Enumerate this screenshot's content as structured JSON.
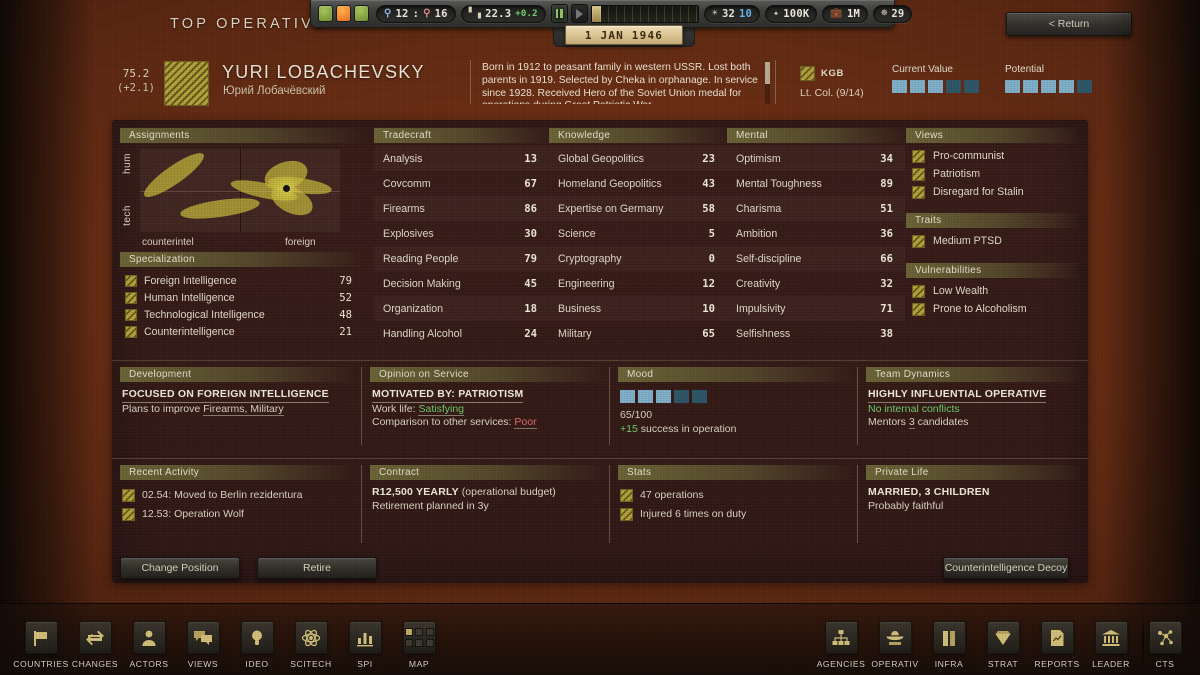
{
  "window": {
    "page_title": "TOP OPERATIVE",
    "return_label": "< Return"
  },
  "statusbar": {
    "dots": [
      "green",
      "orange",
      "green"
    ],
    "population_pill": {
      "blue_value": "12",
      "separator": ":",
      "red_value": "16"
    },
    "economy_pill": {
      "value": "22.3",
      "delta": "+0.2"
    },
    "date": "1 JAN 1946",
    "agents_pill": {
      "value": "32",
      "secondary": "10"
    },
    "money_pill": "100K",
    "budget_pill": "1M",
    "network_pill": "29"
  },
  "operative": {
    "score": "75.2",
    "score_delta": "(+2.1)",
    "name": "YURI LOBACHEVSKY",
    "name_native": "Юрий Лобачёвский",
    "biography": "Born in 1912 to peasant family in western USSR. Lost both parents in 1919. Selected by Cheka in orphanage. In service since 1928.  Received Hero of the Soviet Union medal for operations during Great Patriotic War.",
    "agency": "KGB",
    "rank": "Lt. Col. (9/14)",
    "current_value": {
      "label": "Current Value",
      "filled": 3,
      "total": 5
    },
    "potential": {
      "label": "Potential",
      "filled": 4,
      "total": 5
    }
  },
  "assignments": {
    "title": "Assignments",
    "axis_y_top": "hum",
    "axis_y_bottom": "tech",
    "axis_x_left": "counterintel",
    "axis_x_right": "foreign"
  },
  "chart_data": {
    "type": "scatter",
    "title": "Assignments",
    "xlabel": "counterintel — foreign",
    "ylabel": "tech — hum",
    "xlim": [
      0,
      100
    ],
    "ylim": [
      0,
      100
    ],
    "grid": true,
    "current_point": {
      "x": 73,
      "y": 52
    },
    "blobs": [
      {
        "x": 17,
        "y": 68,
        "rx": 18,
        "ry": 11,
        "rot": -35
      },
      {
        "x": 40,
        "y": 28,
        "rx": 20,
        "ry": 10,
        "rot": -8
      },
      {
        "x": 62,
        "y": 50,
        "rx": 17,
        "ry": 9,
        "rot": 12
      },
      {
        "x": 73,
        "y": 68,
        "rx": 11,
        "ry": 16,
        "rot": -18
      },
      {
        "x": 80,
        "y": 56,
        "rx": 16,
        "ry": 9,
        "rot": 8
      },
      {
        "x": 76,
        "y": 38,
        "rx": 11,
        "ry": 15,
        "rot": 25
      }
    ]
  },
  "specialization": {
    "title": "Specialization",
    "items": [
      {
        "label": "Foreign Intelligence",
        "value": "79"
      },
      {
        "label": "Human Intelligence",
        "value": "52"
      },
      {
        "label": "Technological Intelligence",
        "value": "48"
      },
      {
        "label": "Counterintelligence",
        "value": "21"
      }
    ]
  },
  "tradecraft": {
    "title": "Tradecraft",
    "items": [
      {
        "label": "Analysis",
        "value": "13"
      },
      {
        "label": "Covcomm",
        "value": "67"
      },
      {
        "label": "Firearms",
        "value": "86"
      },
      {
        "label": "Explosives",
        "value": "30"
      },
      {
        "label": "Reading People",
        "value": "79"
      },
      {
        "label": "Decision Making",
        "value": "45"
      },
      {
        "label": "Organization",
        "value": "18"
      },
      {
        "label": "Handling Alcohol",
        "value": "24"
      }
    ]
  },
  "knowledge": {
    "title": "Knowledge",
    "items": [
      {
        "label": "Global Geopolitics",
        "value": "23"
      },
      {
        "label": "Homeland Geopolitics",
        "value": "43"
      },
      {
        "label": "Expertise on Germany",
        "value": "58"
      },
      {
        "label": "Science",
        "value": "5"
      },
      {
        "label": "Cryptography",
        "value": "0"
      },
      {
        "label": "Engineering",
        "value": "12"
      },
      {
        "label": "Business",
        "value": "10"
      },
      {
        "label": "Military",
        "value": "65"
      }
    ]
  },
  "mental": {
    "title": "Mental",
    "items": [
      {
        "label": "Optimism",
        "value": "34"
      },
      {
        "label": "Mental Toughness",
        "value": "89"
      },
      {
        "label": "Charisma",
        "value": "51"
      },
      {
        "label": "Ambition",
        "value": "36"
      },
      {
        "label": "Self-discipline",
        "value": "66"
      },
      {
        "label": "Creativity",
        "value": "32"
      },
      {
        "label": "Impulsivity",
        "value": "71"
      },
      {
        "label": "Selfishness",
        "value": "38"
      }
    ]
  },
  "views": {
    "title": "Views",
    "items": [
      "Pro-communist",
      "Patriotism",
      "Disregard for Stalin"
    ]
  },
  "traits": {
    "title": "Traits",
    "items": [
      "Medium PTSD"
    ]
  },
  "vulnerabilities": {
    "title": "Vulnerabilities",
    "items": [
      "Low Wealth",
      "Prone to Alcoholism"
    ]
  },
  "development": {
    "title": "Development",
    "headline": "FOCUSED ON FOREIGN INTELLIGENCE",
    "line_prefix": "Plans to improve ",
    "line_value": "Firearms, Military"
  },
  "opinion": {
    "title": "Opinion on Service",
    "headline": "MOTIVATED BY: PATRIOTISM",
    "work_life_label": "Work life: ",
    "work_life_value": "Satisfying",
    "comparison_label": "Comparison to other services: ",
    "comparison_value": "Poor"
  },
  "mood": {
    "title": "Mood",
    "filled": 3,
    "total": 5,
    "score": "65/100",
    "bonus": "+15",
    "bonus_text": " success in operation"
  },
  "team_dynamics": {
    "title": "Team Dynamics",
    "headline": "HIGHLY INFLUENTIAL OPERATIVE",
    "conflicts": "No internal conflicts",
    "mentors_prefix": "Mentors ",
    "mentors_count": "3",
    "mentors_suffix": " candidates"
  },
  "recent_activity": {
    "title": "Recent Activity",
    "items": [
      "02.54: Moved to Berlin rezidentura",
      "12.53: Operation Wolf"
    ]
  },
  "contract": {
    "title": "Contract",
    "headline": "R12,500 YEARLY",
    "headline_note": " (operational budget)",
    "line": "Retirement planned in 3y"
  },
  "stats": {
    "title": "Stats",
    "items": [
      "47 operations",
      "Injured 6 times on duty"
    ]
  },
  "private_life": {
    "title": "Private Life",
    "headline": "MARRIED, 3 CHILDREN",
    "line": "Probably faithful"
  },
  "actions": {
    "change_position": "Change Position",
    "retire": "Retire",
    "decoy": "Counterintelligence Decoy"
  },
  "bottom_nav_left": [
    {
      "label": "COUNTRIES",
      "icon": "flag-icon"
    },
    {
      "label": "CHANGES",
      "icon": "arrows-exchange-icon"
    },
    {
      "label": "ACTORS",
      "icon": "person-icon"
    },
    {
      "label": "VIEWS",
      "icon": "speech-bubbles-icon"
    },
    {
      "label": "IDEO",
      "icon": "lightbulb-icon"
    },
    {
      "label": "SCITECH",
      "icon": "atom-icon"
    },
    {
      "label": "SPI",
      "icon": "bar-chart-icon"
    },
    {
      "label": "MAP",
      "icon": "grid-map-icon"
    }
  ],
  "bottom_nav_right": [
    {
      "label": "AGENCIES",
      "icon": "org-chart-icon"
    },
    {
      "label": "OPERATIV",
      "icon": "spy-hat-icon"
    },
    {
      "label": "INFRA",
      "icon": "building-icon"
    },
    {
      "label": "STRAT",
      "icon": "diamond-icon"
    },
    {
      "label": "REPORTS",
      "icon": "document-chart-icon"
    },
    {
      "label": "LEADER",
      "icon": "bank-icon"
    },
    {
      "label": "CTS",
      "icon": "network-nodes-icon"
    }
  ],
  "colors": {
    "accent_gold": "#c9bb3c",
    "leather": "#7a3414",
    "panel": "#34181 6",
    "meter_on": "#7fb0c9",
    "meter_off": "#2d5567",
    "positive": "#6fd06a",
    "negative": "#e06e6e"
  }
}
